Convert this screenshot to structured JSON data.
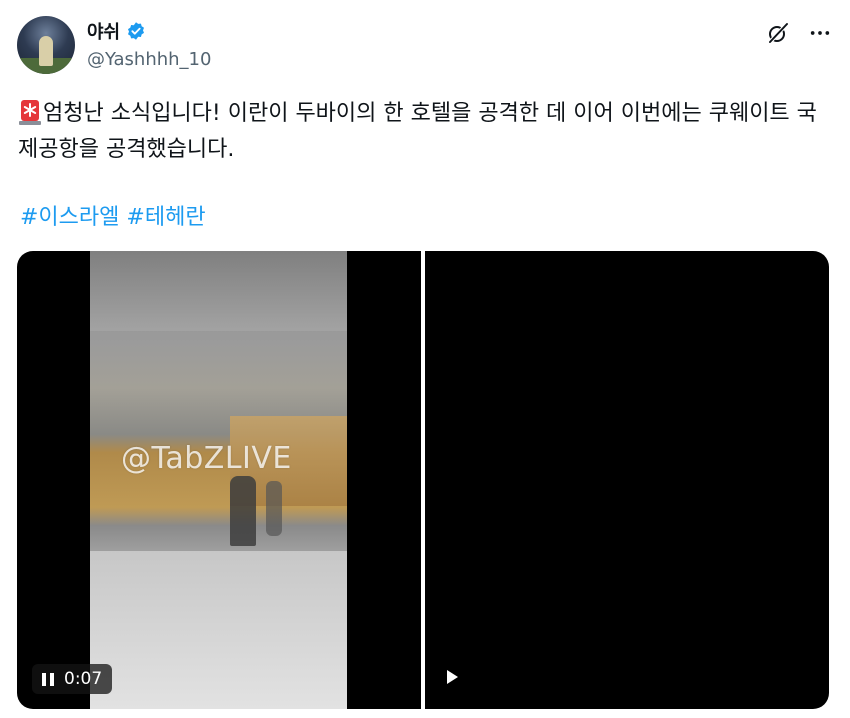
{
  "author": {
    "display_name": "야쉬",
    "handle": "@Yashhhh_10",
    "verified": true
  },
  "icons": {
    "verified": "verified-badge-icon",
    "grok": "grok-icon",
    "more": "more-icon",
    "siren": "siren-emoji-icon",
    "pause": "pause-icon",
    "play": "play-icon"
  },
  "tweet": {
    "text": "엄청난 소식입니다! 이란이 두바이의 한 호텔을 공격한 데 이어 이번에는 쿠웨이트 국제공항을 공격했습니다.",
    "hashtags": [
      "#이스라엘",
      "#테헤란"
    ]
  },
  "media": {
    "video1": {
      "watermark": "@TabZLIVE",
      "time": "0:07",
      "state": "playing"
    },
    "video2": {
      "state": "paused"
    }
  },
  "colors": {
    "link": "#1d9bf0",
    "verified": "#1d9bf0",
    "text": "#0f1419",
    "secondary": "#536471"
  }
}
